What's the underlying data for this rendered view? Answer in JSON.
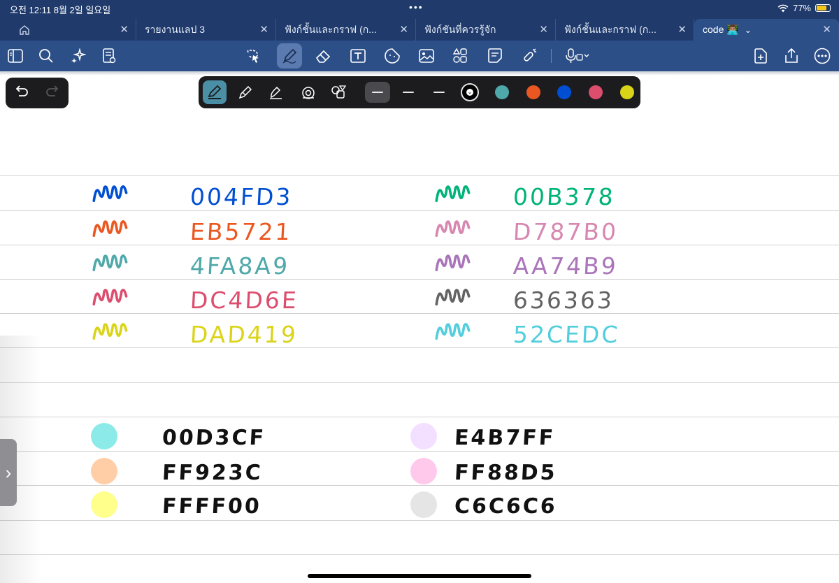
{
  "status_bar": {
    "time_date": "오전 12:11   8월 2일 일요일",
    "dots": "•••",
    "battery": "77%",
    "battery_level": 0.77
  },
  "tabs": [
    {
      "label": "",
      "icon": "home-icon",
      "active": false
    },
    {
      "label": "รายงานแลป 3",
      "active": false
    },
    {
      "label": "ฟังก์ชั้นและกราฟ (ก...",
      "active": false
    },
    {
      "label": "ฟังก์ชันที่ควรรู้จัก",
      "active": false
    },
    {
      "label": "ฟังก์ชั้นและกราฟ (ก...",
      "active": false
    },
    {
      "label": "code 👨🏽‍💻",
      "active": true
    }
  ],
  "toolbar": {
    "left_icons": [
      "sidebar-icon",
      "search-icon",
      "sparkle-icon",
      "document-icon"
    ],
    "center_icons": [
      "lasso-icon",
      "pen-icon",
      "eraser-icon",
      "text-box-icon",
      "sticker-icon",
      "image-icon",
      "shapes-icon",
      "sticky-note-icon",
      "laser-pointer-icon",
      "microphone-icon"
    ],
    "right_icons": [
      "add-page-icon",
      "share-icon",
      "more-icon"
    ],
    "selected": "pen-icon"
  },
  "pen_panel": {
    "tools": [
      "fountain-pen-icon",
      "ball-pen-icon",
      "brush-pen-icon",
      "highlighter-icon",
      "shape-pen-icon"
    ],
    "active_tool": "fountain-pen-icon",
    "swatches": [
      "#000000",
      "#4fa8a9",
      "#eb5721",
      "#004fd3",
      "#dc4d6e",
      "#dad419"
    ]
  },
  "pen_colors": [
    {
      "hex": "004FD3",
      "color": "#004fd3"
    },
    {
      "hex": "EB5721",
      "color": "#eb5721"
    },
    {
      "hex": "4FA8A9",
      "color": "#4fa8a9"
    },
    {
      "hex": "DC4D6E",
      "color": "#dc4d6e"
    },
    {
      "hex": "DAD419",
      "color": "#dad419"
    },
    {
      "hex": "00B378",
      "color": "#00b378"
    },
    {
      "hex": "D787B0",
      "color": "#d787b0"
    },
    {
      "hex": "AA74B9",
      "color": "#aa74b9"
    },
    {
      "hex": "636363",
      "color": "#636363"
    },
    {
      "hex": "52CEDC",
      "color": "#52cedc"
    }
  ],
  "highlighter_colors": [
    {
      "hex": "00D3CF",
      "color": "#00d3cf"
    },
    {
      "hex": "FF923C",
      "color": "#ff923c"
    },
    {
      "hex": "FFFF00",
      "color": "#ffff00"
    },
    {
      "hex": "E4B7FF",
      "color": "#e4b7ff"
    },
    {
      "hex": "FF88D5",
      "color": "#ff88d5"
    },
    {
      "hex": "C6C6C6",
      "color": "#c6c6c6"
    }
  ]
}
